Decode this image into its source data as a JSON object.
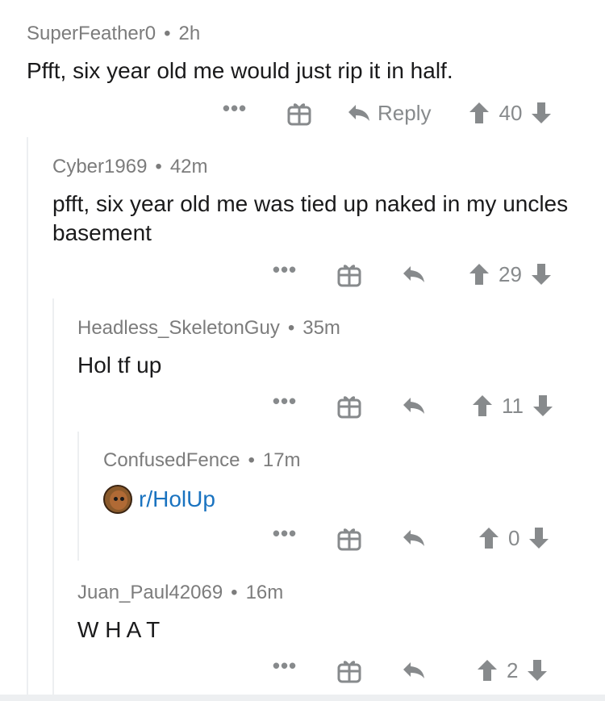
{
  "comments": [
    {
      "user": "SuperFeather0",
      "time": "2h",
      "text": "Pfft, six year old me would just rip it in half.",
      "reply_label": "Reply",
      "score": "40"
    },
    {
      "user": "Cyber1969",
      "time": "42m",
      "text": "pfft, six year old me was tied up naked in my uncles basement",
      "score": "29"
    },
    {
      "user": "Headless_SkeletonGuy",
      "time": "35m",
      "text": "Hol tf up",
      "score": "11"
    },
    {
      "user": "ConfusedFence",
      "time": "17m",
      "link": "r/HolUp",
      "score": "0"
    },
    {
      "user": "Juan_Paul42069",
      "time": "16m",
      "text": "W H A T",
      "score": "2"
    }
  ],
  "ui": {
    "separator": "•",
    "more": "•••"
  },
  "colors": {
    "meta": "#7c7c7c",
    "icon": "#878a8c",
    "link": "#1a73c0",
    "thread": "#edeff1"
  },
  "icons": [
    "more-icon",
    "gift-icon",
    "reply-icon",
    "upvote-icon",
    "downvote-icon",
    "subreddit-avatar-icon"
  ]
}
